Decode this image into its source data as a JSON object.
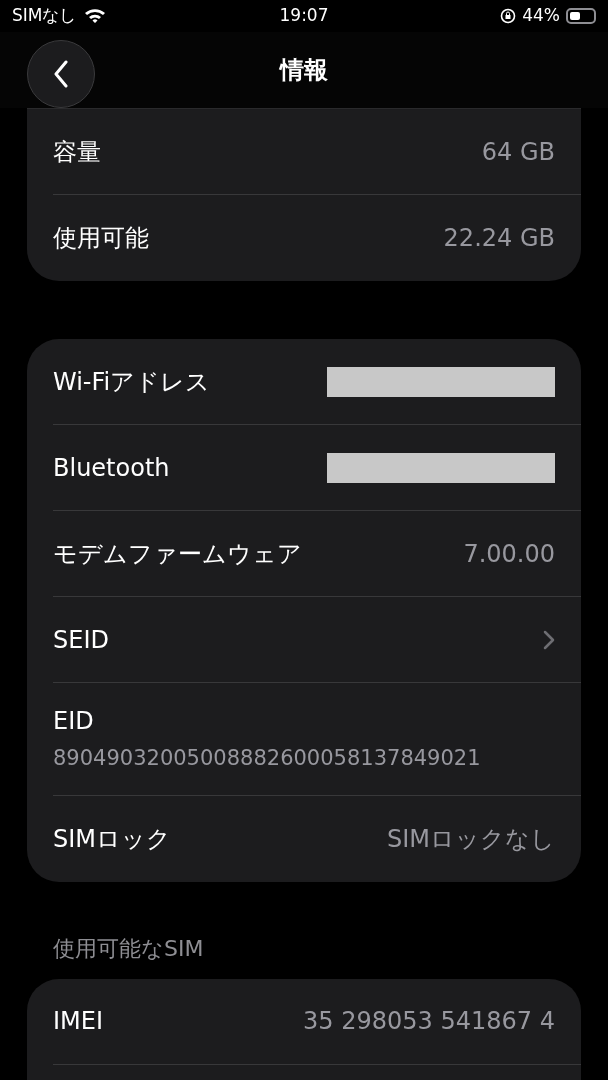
{
  "status_bar": {
    "carrier": "SIMなし",
    "time": "19:07",
    "battery": "44%"
  },
  "nav": {
    "title": "情報"
  },
  "groups": [
    {
      "rows": [
        {
          "kind": "value",
          "label": "容量",
          "value": "64 GB"
        },
        {
          "kind": "value",
          "label": "使用可能",
          "value": "22.24 GB"
        }
      ]
    },
    {
      "rows": [
        {
          "kind": "redacted",
          "label": "Wi-Fiアドレス"
        },
        {
          "kind": "redacted",
          "label": "Bluetooth"
        },
        {
          "kind": "value",
          "label": "モデムファームウェア",
          "value": "7.00.00"
        },
        {
          "kind": "chevron",
          "label": "SEID"
        },
        {
          "kind": "stacked",
          "label": "EID",
          "value": "89049032005008882600058137849021"
        },
        {
          "kind": "value",
          "label": "SIMロック",
          "value": "SIMロックなし"
        }
      ]
    },
    {
      "header": "使用可能なSIM",
      "rows": [
        {
          "kind": "value",
          "label": "IMEI",
          "value": "35 298053 541867 4"
        }
      ]
    }
  ]
}
